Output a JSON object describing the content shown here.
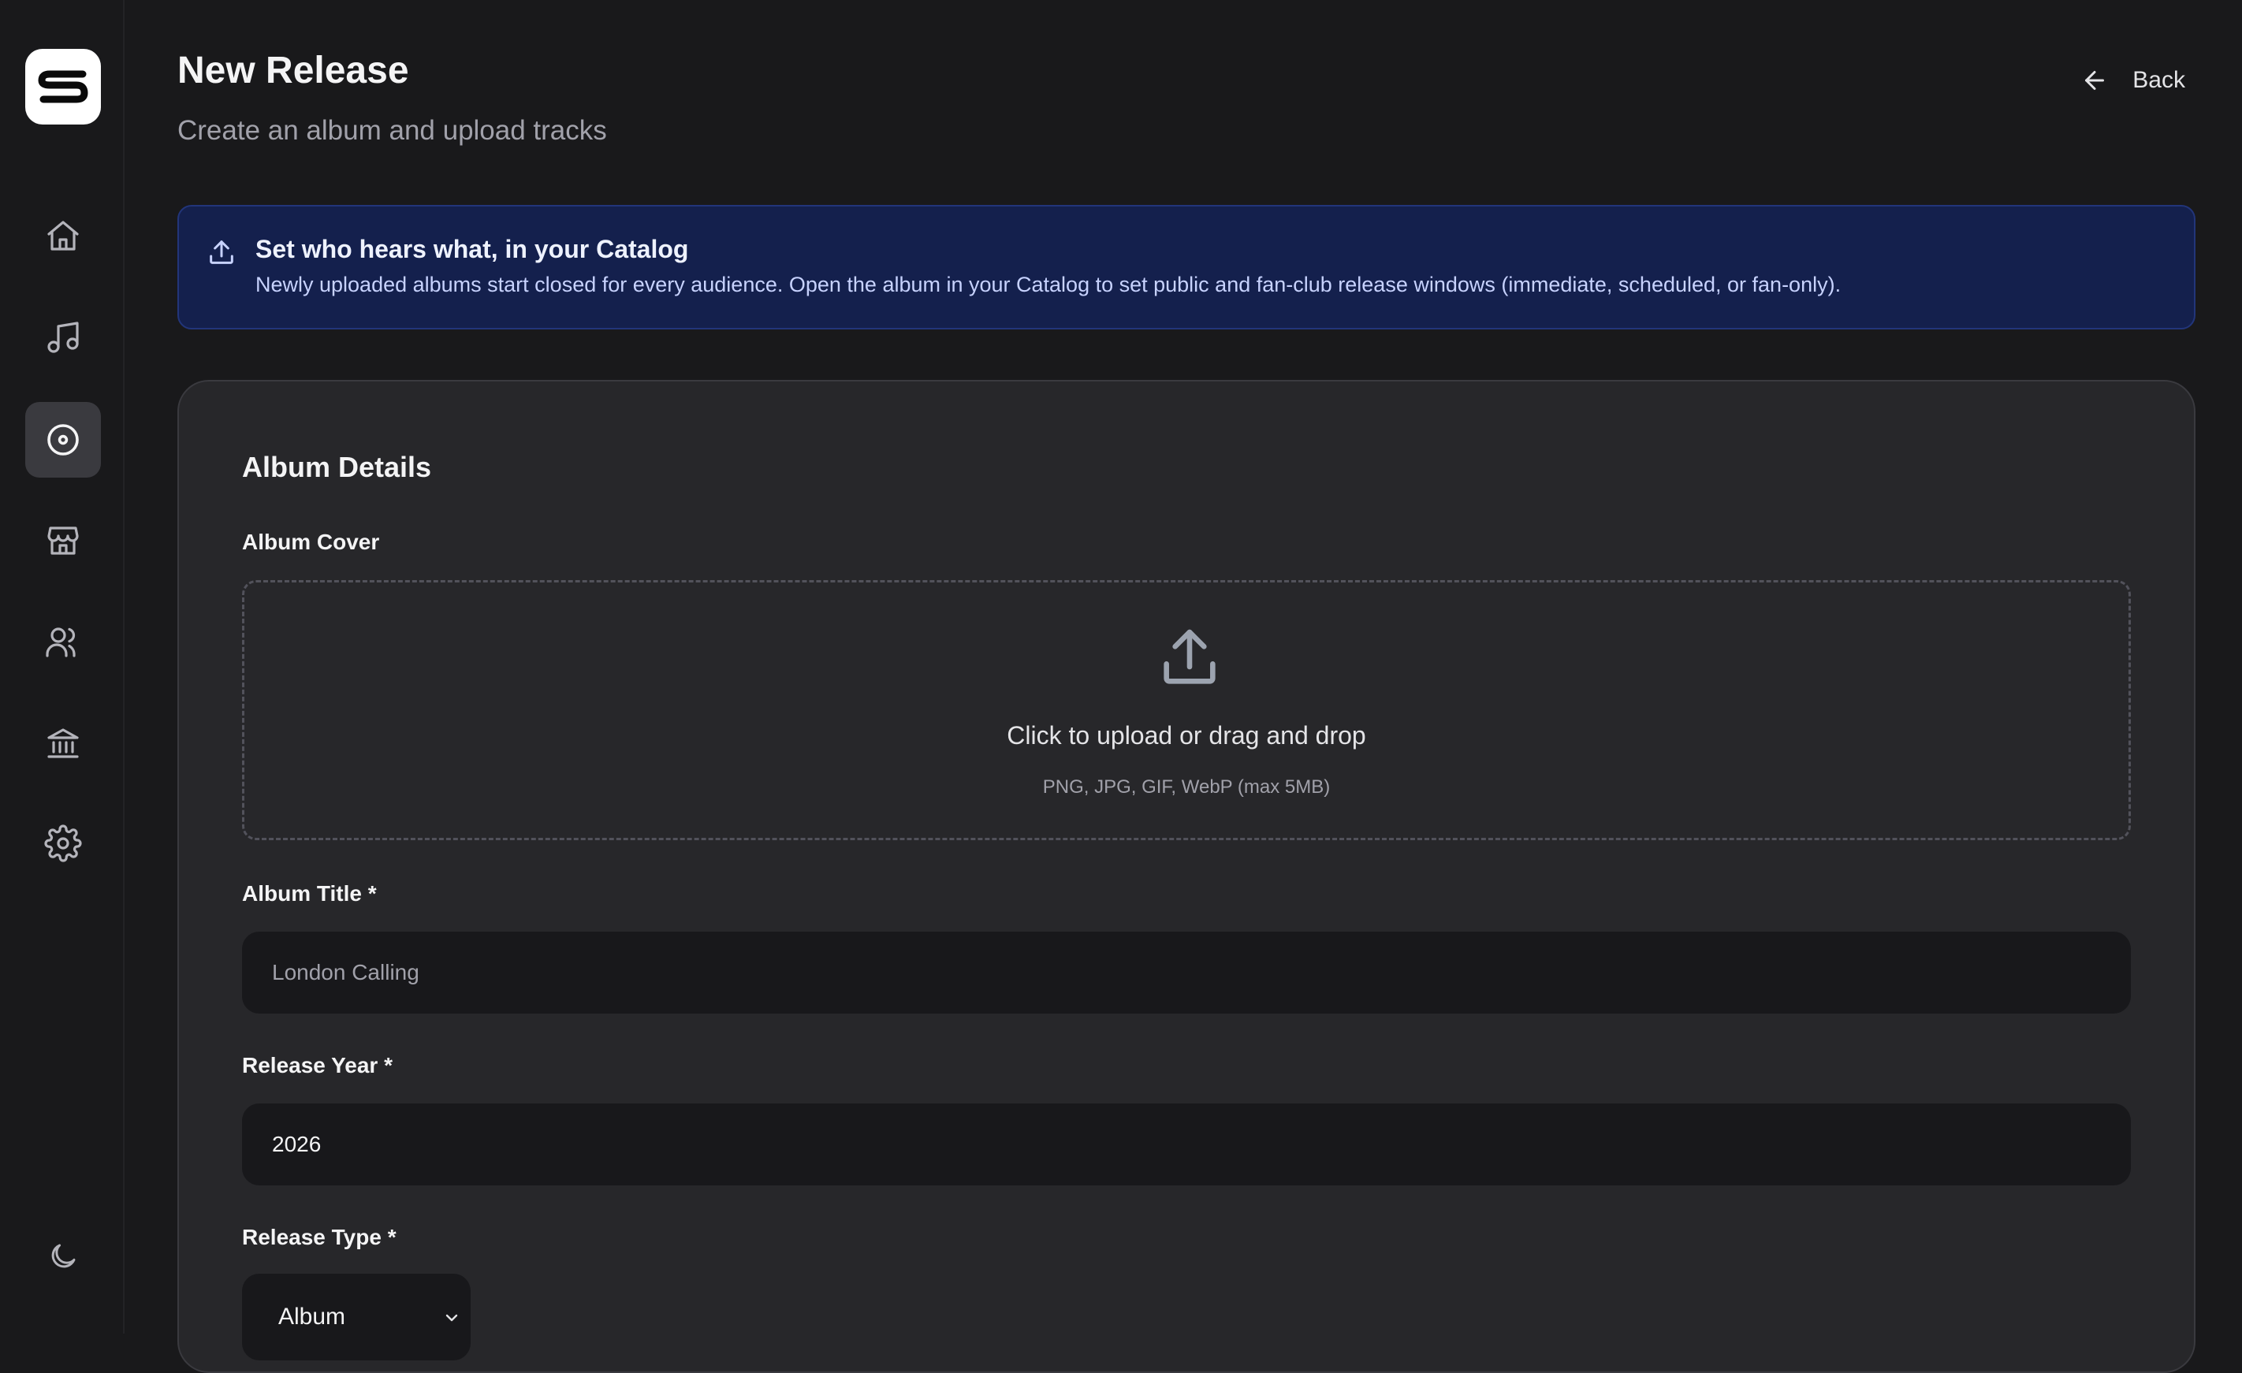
{
  "app": {
    "logo_icon": "s-logo-icon"
  },
  "sidebar": {
    "items": [
      {
        "name": "home",
        "icon": "home-icon",
        "active": false
      },
      {
        "name": "music",
        "icon": "music-note-icon",
        "active": false
      },
      {
        "name": "releases",
        "icon": "disc-icon",
        "active": true
      },
      {
        "name": "store",
        "icon": "store-icon",
        "active": false
      },
      {
        "name": "fans",
        "icon": "users-icon",
        "active": false
      },
      {
        "name": "bank",
        "icon": "bank-icon",
        "active": false
      },
      {
        "name": "settings",
        "icon": "gear-icon",
        "active": false
      }
    ],
    "theme_toggle_icon": "moon-icon"
  },
  "header": {
    "title": "New Release",
    "subtitle": "Create an album and upload tracks",
    "back_label": "Back"
  },
  "banner": {
    "title": "Set who hears what, in your Catalog",
    "text": "Newly uploaded albums start closed for every audience. Open the album in your Catalog to set public and fan-club release windows (immediate, scheduled, or fan-only)."
  },
  "form": {
    "section_title": "Album Details",
    "cover": {
      "label": "Album Cover",
      "prompt": "Click to upload or drag and drop",
      "hint": "PNG, JPG, GIF, WebP (max 5MB)"
    },
    "album_title": {
      "label": "Album Title *",
      "value": "",
      "placeholder": "London Calling"
    },
    "release_year": {
      "label": "Release Year *",
      "value": "2026"
    },
    "release_type": {
      "label": "Release Type *",
      "selected": "Album"
    }
  },
  "colors": {
    "background": "#19191b",
    "card": "#27272a",
    "banner_bg": "#14204d",
    "banner_border": "#22357a",
    "active_nav": "#3a3a3f"
  }
}
